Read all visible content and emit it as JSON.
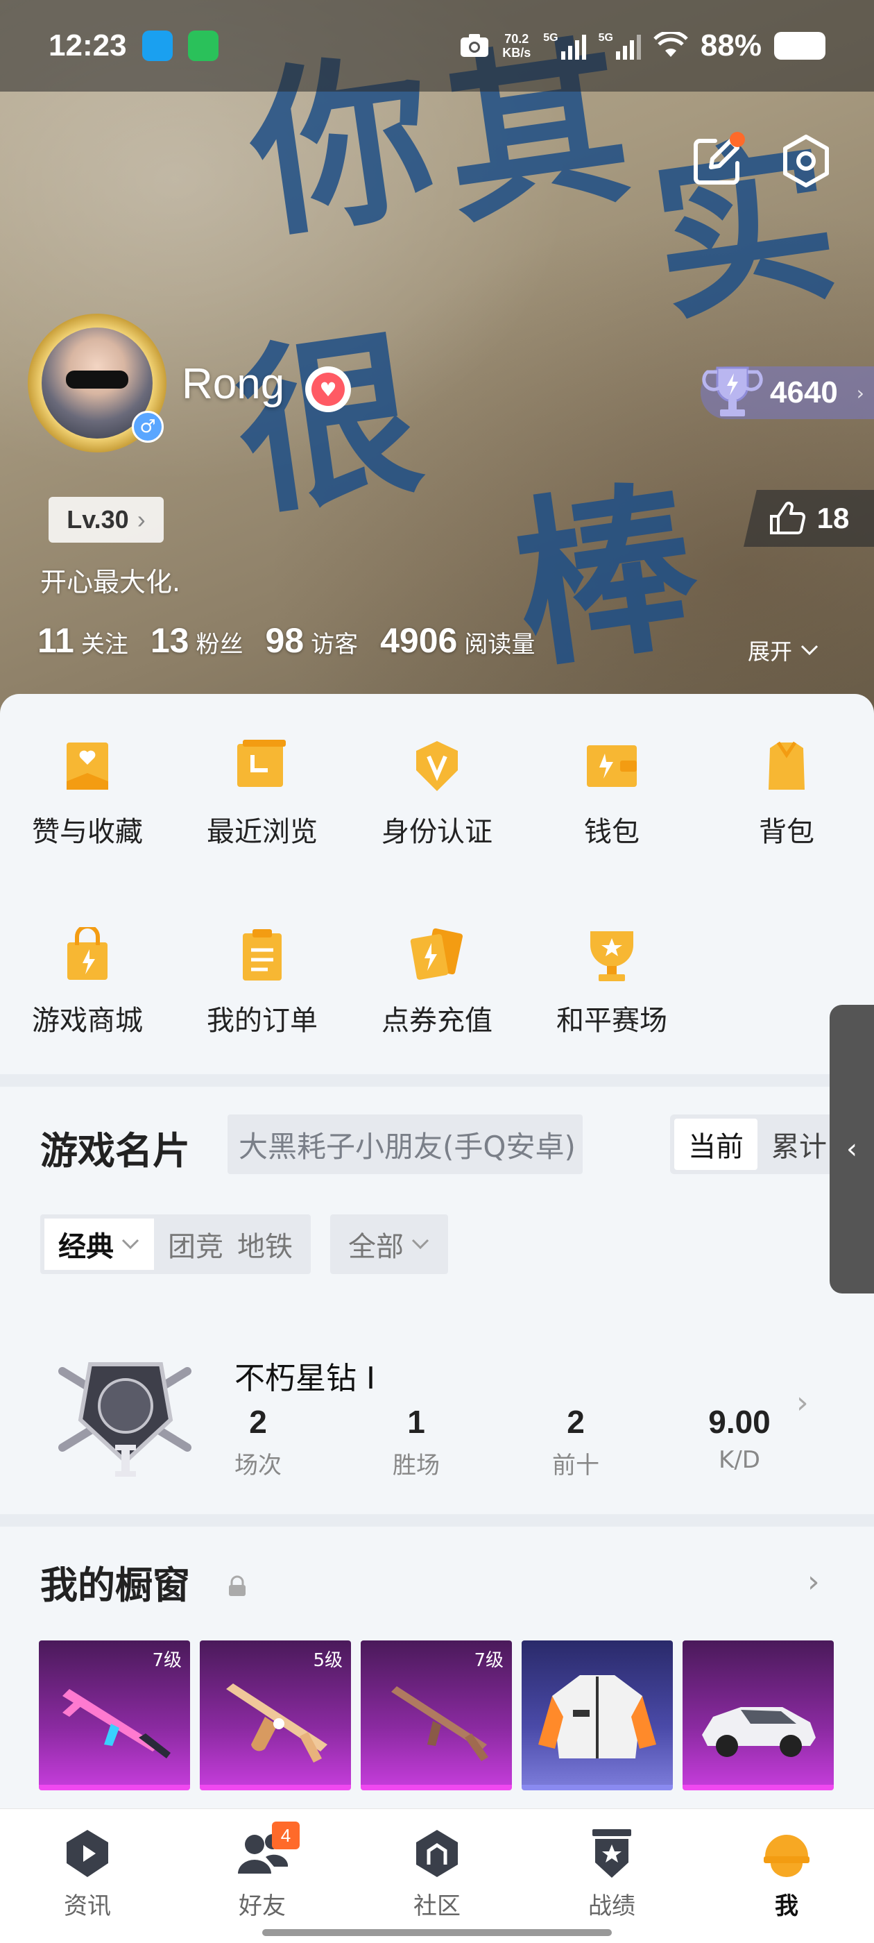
{
  "status_bar": {
    "time": "12:23",
    "net_speed_value": "70.2",
    "net_speed_unit": "KB/s",
    "sig_tag_1": "5G",
    "sig_tag_2": "5G",
    "battery": "88%"
  },
  "profile": {
    "username": "Rong",
    "trophy_score": "4640",
    "level": "Lv.30",
    "likes": "18",
    "bio": "开心最大化.",
    "stats": [
      {
        "num": "11",
        "label": "关注"
      },
      {
        "num": "13",
        "label": "粉丝"
      },
      {
        "num": "98",
        "label": "访客"
      },
      {
        "num": "4906",
        "label": "阅读量"
      }
    ],
    "expand_label": "展开",
    "background_text": [
      "你",
      "其",
      "实",
      "很",
      "棒"
    ]
  },
  "quick_actions": [
    {
      "label": "赞与收藏",
      "icon": "heart-folder-icon"
    },
    {
      "label": "最近浏览",
      "icon": "history-icon"
    },
    {
      "label": "身份认证",
      "icon": "verify-icon"
    },
    {
      "label": "钱包",
      "icon": "wallet-icon"
    },
    {
      "label": "背包",
      "icon": "backpack-icon"
    },
    {
      "label": "游戏商城",
      "icon": "shop-bag-icon"
    },
    {
      "label": "我的订单",
      "icon": "order-icon"
    },
    {
      "label": "点券充值",
      "icon": "coupon-icon"
    },
    {
      "label": "和平赛场",
      "icon": "arena-icon"
    }
  ],
  "game_card": {
    "title": "游戏名片",
    "account_tag": "大黑耗子小朋友(手Q安卓)",
    "segments": [
      "当前",
      "累计"
    ],
    "filters_mode": "经典",
    "filters_other": [
      "团竞",
      "地铁"
    ],
    "filters_scope": "全部",
    "rank": {
      "name": "不朽星钻 I",
      "stats": [
        {
          "value": "2",
          "label": "场次"
        },
        {
          "value": "1",
          "label": "胜场"
        },
        {
          "value": "2",
          "label": "前十"
        },
        {
          "value": "9.00",
          "label": "K/D"
        }
      ]
    }
  },
  "showcase": {
    "title": "我的橱窗",
    "items": [
      {
        "level": "7级",
        "kind": "rifle-pink"
      },
      {
        "level": "5级",
        "kind": "rifle-gold"
      },
      {
        "level": "7级",
        "kind": "rifle-brown"
      },
      {
        "level": "",
        "kind": "jacket"
      },
      {
        "level": "",
        "kind": "car"
      }
    ]
  },
  "bottom_nav": [
    {
      "label": "资讯",
      "icon": "news-icon",
      "badge": ""
    },
    {
      "label": "好友",
      "icon": "friends-icon",
      "badge": "4"
    },
    {
      "label": "社区",
      "icon": "community-icon",
      "badge": ""
    },
    {
      "label": "战绩",
      "icon": "record-icon",
      "badge": ""
    },
    {
      "label": "我",
      "icon": "me-icon",
      "badge": "",
      "active": true
    }
  ],
  "colors": {
    "accent_orange": "#F5A623",
    "notif": "#FF6A2A"
  }
}
